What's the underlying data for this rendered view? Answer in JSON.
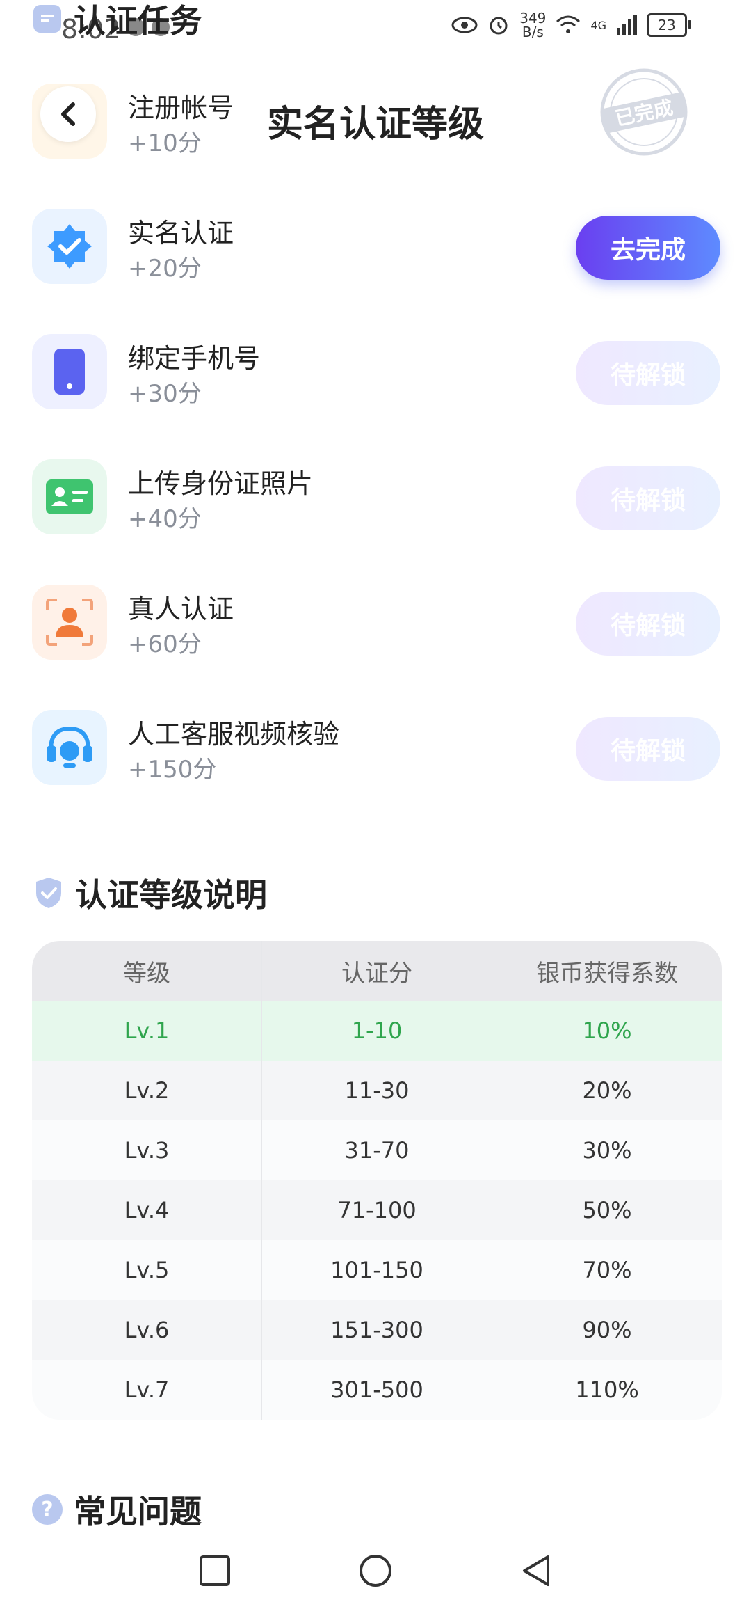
{
  "status_bar": {
    "time": "8:02",
    "net_speed_value": "349",
    "net_speed_unit": "B/s",
    "network_type": "4G",
    "battery": "23"
  },
  "top_section": {
    "title": "认证任务"
  },
  "header": {
    "title": "实名认证等级"
  },
  "tasks": [
    {
      "name": "注册帐号",
      "score": "+10分",
      "status": "已完成",
      "icon": "user-register-icon",
      "icon_bg": "#fff6e8"
    },
    {
      "name": "实名认证",
      "score": "+20分",
      "button": "去完成",
      "icon": "verified-badge-icon",
      "icon_bg": "#eaf3ff"
    },
    {
      "name": "绑定手机号",
      "score": "+30分",
      "button": "待解锁",
      "icon": "phone-icon",
      "icon_bg": "#eef0ff"
    },
    {
      "name": "上传身份证照片",
      "score": "+40分",
      "button": "待解锁",
      "icon": "id-card-icon",
      "icon_bg": "#e8f8ee"
    },
    {
      "name": "真人认证",
      "score": "+60分",
      "button": "待解锁",
      "icon": "face-scan-icon",
      "icon_bg": "#fff1e8"
    },
    {
      "name": "人工客服视频核验",
      "score": "+150分",
      "button": "待解锁",
      "icon": "headset-icon",
      "icon_bg": "#e8f4ff"
    }
  ],
  "level_section": {
    "title": "认证等级说明",
    "columns": [
      "等级",
      "认证分",
      "银币获得系数"
    ],
    "rows": [
      [
        "Lv.1",
        "1-10",
        "10%"
      ],
      [
        "Lv.2",
        "11-30",
        "20%"
      ],
      [
        "Lv.3",
        "31-70",
        "30%"
      ],
      [
        "Lv.4",
        "71-100",
        "50%"
      ],
      [
        "Lv.5",
        "101-150",
        "70%"
      ],
      [
        "Lv.6",
        "151-300",
        "90%"
      ],
      [
        "Lv.7",
        "301-500",
        "110%"
      ]
    ]
  },
  "faq_section": {
    "title": "常见问题",
    "icon_glyph": "?"
  },
  "colors": {
    "accent_start": "#6a3ff0",
    "accent_end": "#5e8bff",
    "highlight_text": "#2fa54d",
    "highlight_bg": "#e6f8ec"
  }
}
